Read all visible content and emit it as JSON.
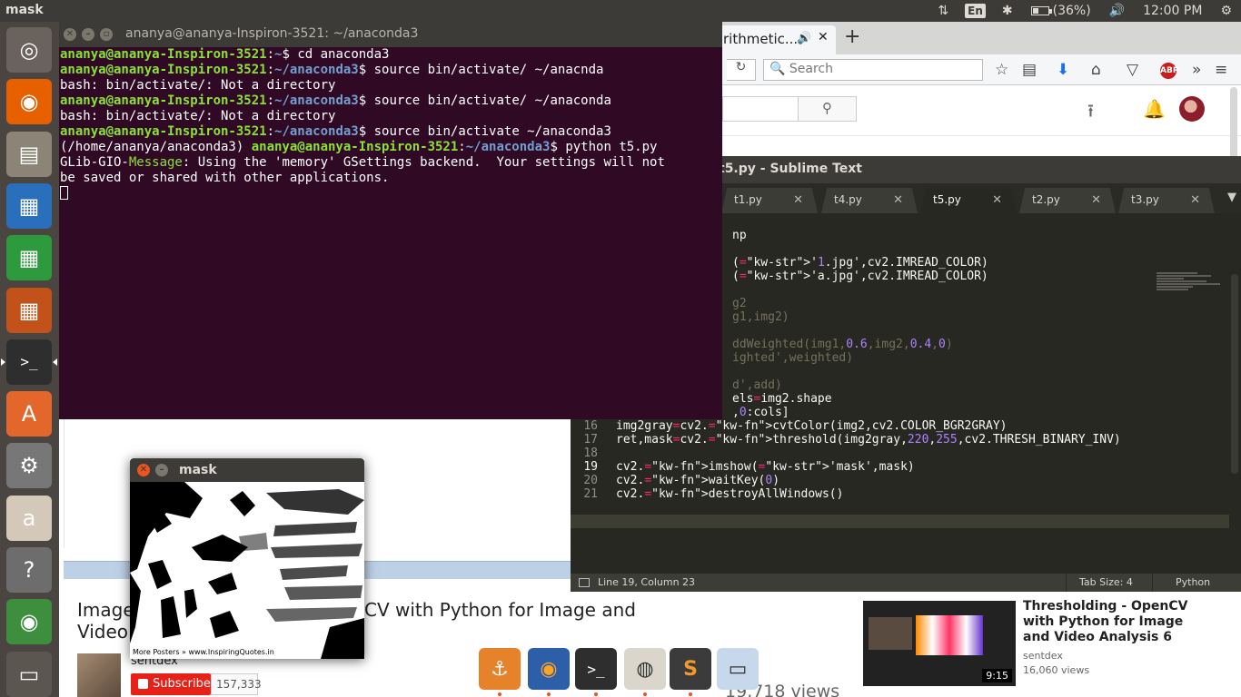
{
  "top_panel": {
    "app_name": "mask",
    "language": "En",
    "battery": "(36%)",
    "battery_level": 0.36,
    "time": "12:00 PM"
  },
  "launcher": {
    "items": [
      {
        "name": "ubuntu-dash-icon",
        "glyph": "◎",
        "color": "#6a625c"
      },
      {
        "name": "firefox-icon",
        "glyph": "◉",
        "color": "#e66000"
      },
      {
        "name": "files-icon",
        "glyph": "▤",
        "color": "#8d8478"
      },
      {
        "name": "libreoffice-writer-icon",
        "glyph": "▦",
        "color": "#2a6fbb"
      },
      {
        "name": "libreoffice-calc-icon",
        "glyph": "▦",
        "color": "#2e9a3e"
      },
      {
        "name": "libreoffice-impress-icon",
        "glyph": "▦",
        "color": "#c2511a"
      },
      {
        "name": "terminal-icon",
        "glyph": ">_",
        "color": "#2e2e2e"
      },
      {
        "name": "software-center-icon",
        "glyph": "A",
        "color": "#e3662b"
      },
      {
        "name": "system-settings-icon",
        "glyph": "⚙",
        "color": "#777777"
      },
      {
        "name": "amazon-icon",
        "glyph": "a",
        "color": "#d4c9b9"
      },
      {
        "name": "help-icon",
        "glyph": "?",
        "color": "#6d6d6d"
      },
      {
        "name": "chrome-icon",
        "glyph": "◉",
        "color": "#3d8f3d"
      },
      {
        "name": "workspace-switcher-icon",
        "glyph": "▭",
        "color": "#5c5650"
      }
    ]
  },
  "firefox": {
    "tab_label": "rithmetic...",
    "search_placeholder": "Search",
    "reload_glyph": "↻",
    "new_tab_glyph": "+",
    "abp": "ABP",
    "video_title_line1a": "Image",
    "video_title_line1b": "CV with Python for Image and",
    "video_title_line2": "Video",
    "channel": "sentdex",
    "subscribe": "Subscribe",
    "subscribers": "157,333",
    "views": "19,718 views",
    "related": {
      "title": "Thresholding - OpenCV with Python for Image and Video Analysis 6",
      "channel": "sentdex",
      "views": "16,060 views",
      "duration": "9:15"
    }
  },
  "terminal": {
    "title": "ananya@ananya-Inspiron-3521: ~/anaconda3",
    "lines": [
      {
        "user": "ananya@ananya-Inspiron-3521",
        "path": "~",
        "cmd": " cd anaconda3"
      },
      {
        "user": "ananya@ananya-Inspiron-3521",
        "path": "~/anaconda3",
        "cmd": " source bin/activate/ ~/anacnda"
      },
      {
        "plain": "bash: bin/activate/: Not a directory"
      },
      {
        "user": "ananya@ananya-Inspiron-3521",
        "path": "~/anaconda3",
        "cmd": " source bin/activate/ ~/anaconda"
      },
      {
        "plain": "bash: bin/activate/: Not a directory"
      },
      {
        "user": "ananya@ananya-Inspiron-3521",
        "path": "~/anaconda3",
        "cmd": " source bin/activate ~/anaconda3"
      },
      {
        "env": "(/home/ananya/anaconda3) ",
        "user": "ananya@ananya-Inspiron-3521",
        "path": "~/anaconda3",
        "cmd": " python t5.py"
      },
      {
        "glib": "GLib-GIO-",
        "msg": "Message",
        "rest": ": Using the 'memory' GSettings backend.  Your settings will not"
      },
      {
        "plain": "be saved or shared with other applications."
      }
    ]
  },
  "sublime": {
    "title": "t5.py - Sublime Text",
    "tabs": [
      {
        "label": "t1.py",
        "active": false
      },
      {
        "label": "t4.py",
        "active": false
      },
      {
        "label": "t5.py",
        "active": true
      },
      {
        "label": "t2.py",
        "active": false
      },
      {
        "label": "t3.py",
        "active": false
      }
    ],
    "code": [
      {
        "ln": "",
        "text": "np"
      },
      {
        "ln": "",
        "text": ""
      },
      {
        "ln": "",
        "text": "('1.jpg',cv2.IMREAD_COLOR)"
      },
      {
        "ln": "",
        "text": "('a.jpg',cv2.IMREAD_COLOR)"
      },
      {
        "ln": "",
        "text": ""
      },
      {
        "ln": "",
        "text": "g2"
      },
      {
        "ln": "",
        "text": "g1,img2)"
      },
      {
        "ln": "",
        "text": ""
      },
      {
        "ln": "",
        "text": "ddWeighted(img1,0.6,img2,0.4,0)"
      },
      {
        "ln": "",
        "text": "ighted',weighted)"
      },
      {
        "ln": "",
        "text": ""
      },
      {
        "ln": "",
        "text": "d',add)"
      },
      {
        "ln": "",
        "text": "els=img2.shape"
      },
      {
        "ln": "",
        "text": ",0:cols]"
      },
      {
        "ln": "16",
        "text": "img2gray=cv2.cvtColor(img2,cv2.COLOR_BGR2GRAY)"
      },
      {
        "ln": "17",
        "text": "ret,mask=cv2.threshold(img2gray,220,255,cv2.THRESH_BINARY_INV)"
      },
      {
        "ln": "18",
        "text": ""
      },
      {
        "ln": "19",
        "text": "cv2.imshow('mask',mask)"
      },
      {
        "ln": "20",
        "text": "cv2.waitKey(0)"
      },
      {
        "ln": "21",
        "text": "cv2.destroyAllWindows()"
      }
    ],
    "status": {
      "position": "Line 19, Column 23",
      "tab_size": "Tab Size: 4",
      "syntax": "Python"
    }
  },
  "mask_window": {
    "title": "mask",
    "caption": "More Posters » www.InspiringQuotes.in"
  }
}
